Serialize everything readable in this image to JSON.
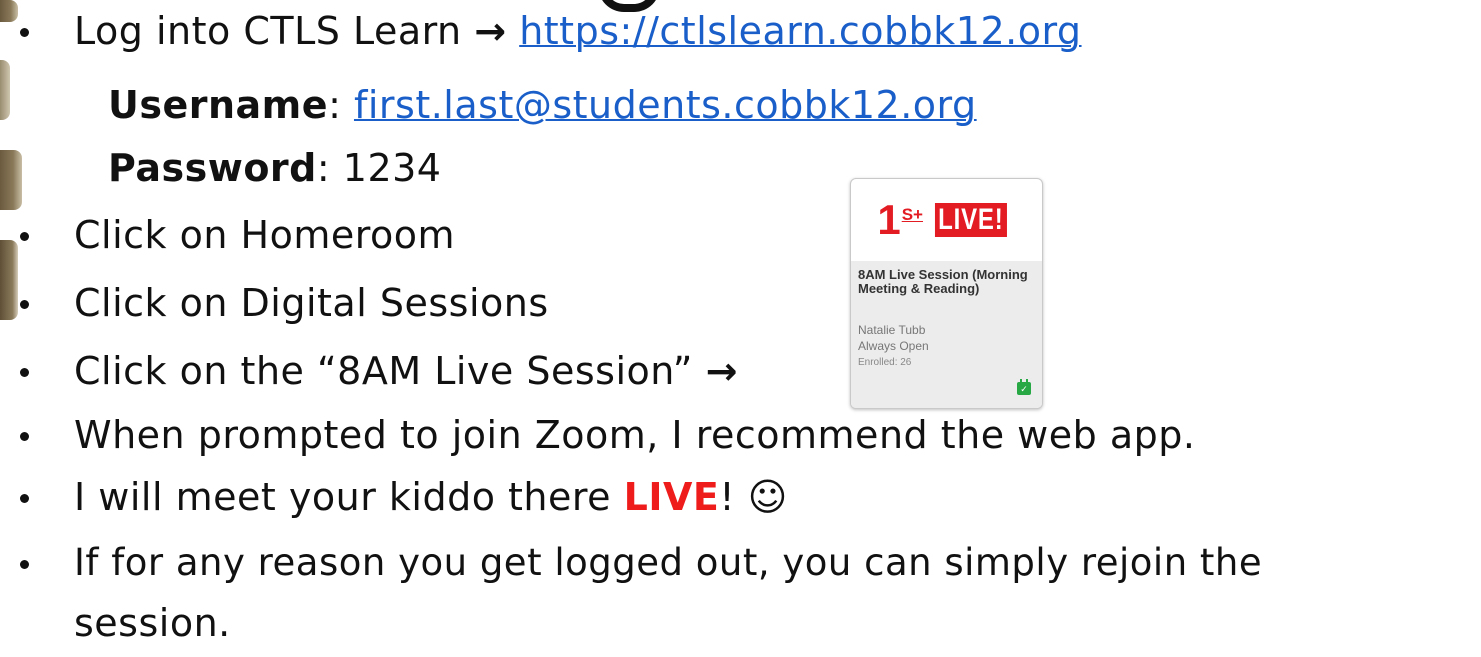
{
  "instructions": [
    {
      "text": "Log into CTLS Learn",
      "arrow": "→",
      "link": "https://ctlslearn.cobbk12.org"
    },
    {
      "label": "Username",
      "link": "first.last@students.cobbk12.org"
    },
    {
      "label": "Password",
      "value": "1234"
    },
    {
      "text": "Click on Homeroom"
    },
    {
      "text": "Click on Digital Sessions"
    },
    {
      "text": "Click on the “8AM Live Session”",
      "arrow": "→"
    },
    {
      "text": "When prompted to join Zoom, I recommend the web app."
    },
    {
      "text_before": "I will meet your kiddo there ",
      "highlight": "LIVE",
      "text_after": "! ☺"
    },
    {
      "text": "If for any reason you get logged out, you can simply rejoin the"
    },
    {
      "text": "session."
    }
  ],
  "card": {
    "logo_number": "1",
    "logo_super": "S+",
    "logo_badge": "LIVE!",
    "title": "8AM Live Session (Morning Meeting & Reading)",
    "teacher": "Natalie Tubb",
    "availability": "Always Open",
    "enrolled": "Enrolled: 26",
    "icon": "calendar-check-icon"
  },
  "colors": {
    "link": "#1a5fc9",
    "live": "#ef1c1c",
    "badge": "#e31b23",
    "calendar": "#27a844"
  }
}
